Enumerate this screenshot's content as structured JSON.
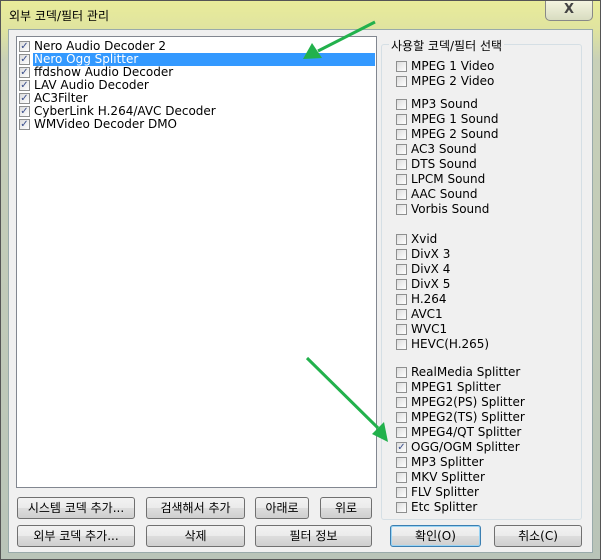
{
  "window": {
    "title": "외부 코덱/필터 관리",
    "close_label": "X"
  },
  "filter_list": [
    {
      "label": "Nero Audio Decoder 2",
      "checked": true,
      "selected": false
    },
    {
      "label": "Nero Ogg Splitter",
      "checked": true,
      "selected": true
    },
    {
      "label": "ffdshow Audio Decoder",
      "checked": true,
      "selected": false
    },
    {
      "label": "LAV Audio Decoder",
      "checked": true,
      "selected": false
    },
    {
      "label": "AC3Filter",
      "checked": true,
      "selected": false
    },
    {
      "label": "CyberLink H.264/AVC Decoder",
      "checked": true,
      "selected": false
    },
    {
      "label": "WMVideo Decoder DMO",
      "checked": true,
      "selected": false
    }
  ],
  "codec_group": {
    "title": "사용할 코덱/필터 선택",
    "sections": [
      [
        {
          "label": "MPEG 1 Video",
          "checked": false
        },
        {
          "label": "MPEG 2 Video",
          "checked": false
        }
      ],
      [
        {
          "label": "MP3 Sound",
          "checked": false
        },
        {
          "label": "MPEG 1 Sound",
          "checked": false
        },
        {
          "label": "MPEG 2 Sound",
          "checked": false
        },
        {
          "label": "AC3 Sound",
          "checked": false
        },
        {
          "label": "DTS Sound",
          "checked": false
        },
        {
          "label": "LPCM Sound",
          "checked": false
        },
        {
          "label": "AAC Sound",
          "checked": false
        },
        {
          "label": "Vorbis Sound",
          "checked": false
        }
      ],
      [
        {
          "label": "Xvid",
          "checked": false
        },
        {
          "label": "DivX 3",
          "checked": false
        },
        {
          "label": "DivX 4",
          "checked": false
        },
        {
          "label": "DivX 5",
          "checked": false
        },
        {
          "label": "H.264",
          "checked": false
        },
        {
          "label": "AVC1",
          "checked": false
        },
        {
          "label": "WVC1",
          "checked": false
        },
        {
          "label": "HEVC(H.265)",
          "checked": false
        }
      ],
      [
        {
          "label": "RealMedia Splitter",
          "checked": false
        },
        {
          "label": "MPEG1 Splitter",
          "checked": false
        },
        {
          "label": "MPEG2(PS) Splitter",
          "checked": false
        },
        {
          "label": "MPEG2(TS) Splitter",
          "checked": false
        },
        {
          "label": "MPEG4/QT Splitter",
          "checked": false
        },
        {
          "label": "OGG/OGM Splitter",
          "checked": true
        },
        {
          "label": "MP3 Splitter",
          "checked": false
        },
        {
          "label": "MKV Splitter",
          "checked": false
        },
        {
          "label": "FLV Splitter",
          "checked": false
        },
        {
          "label": "Etc Splitter",
          "checked": false
        }
      ]
    ]
  },
  "buttons": {
    "add_system": "시스템 코덱 추가...",
    "search_add": "검색해서 추가",
    "down": "아래로",
    "up": "위로",
    "add_external": "외부 코덱  추가...",
    "delete": "삭제",
    "filter_info": "필터 정보",
    "ok": "확인(O)",
    "cancel": "취소(C)"
  },
  "annotation_color": "#22b14c"
}
